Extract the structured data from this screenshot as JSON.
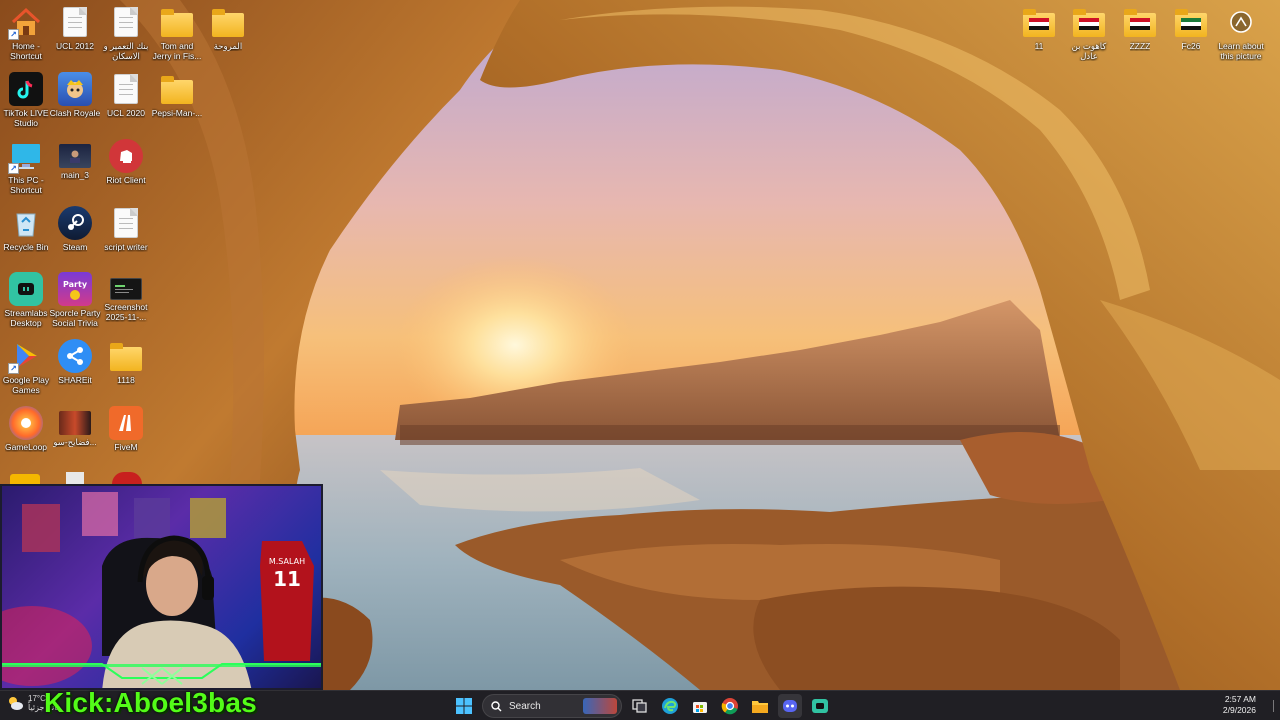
{
  "desktop": {
    "icons": [
      {
        "id": "home",
        "label": "Home - Shortcut",
        "icon": "home-icon"
      },
      {
        "id": "ucl2012",
        "label": "UCL 2012",
        "icon": "document-icon"
      },
      {
        "id": "bank",
        "label": "بنك التعمير و الاسكان",
        "icon": "document-icon"
      },
      {
        "id": "tomjerry",
        "label": "Tom and Jerry in Fis...",
        "icon": "folder-icon"
      },
      {
        "id": "fan",
        "label": "المروحة",
        "icon": "folder-icon"
      },
      {
        "id": "tiktok",
        "label": "TikTok LIVE Studio",
        "icon": "tiktok-icon"
      },
      {
        "id": "clash",
        "label": "Clash Royale",
        "icon": "clash-royale-icon"
      },
      {
        "id": "ucl2020",
        "label": "UCL 2020",
        "icon": "document-icon"
      },
      {
        "id": "pepsi",
        "label": "Pepsi-Man-...",
        "icon": "folder-icon"
      },
      {
        "id": "thispc",
        "label": "This PC - Shortcut",
        "icon": "monitor-icon"
      },
      {
        "id": "main3",
        "label": "main_3",
        "icon": "video-thumbnail-icon"
      },
      {
        "id": "riot",
        "label": "Riot Client",
        "icon": "riot-icon"
      },
      {
        "id": "recycle",
        "label": "Recycle Bin",
        "icon": "recycle-bin-icon"
      },
      {
        "id": "steam",
        "label": "Steam",
        "icon": "steam-icon"
      },
      {
        "id": "script",
        "label": "script writer",
        "icon": "document-icon"
      },
      {
        "id": "streamlabs",
        "label": "Streamlabs Desktop",
        "icon": "streamlabs-icon"
      },
      {
        "id": "sporcle",
        "label": "Sporcle Party Social Trivia",
        "icon": "sporcle-icon"
      },
      {
        "id": "screenshot",
        "label": "Screenshot 2025-11-...",
        "icon": "image-thumbnail-icon"
      },
      {
        "id": "gplay",
        "label": "Google Play Games",
        "icon": "google-play-icon"
      },
      {
        "id": "shareit",
        "label": "SHAREit",
        "icon": "shareit-icon"
      },
      {
        "id": "f1118",
        "label": "1118",
        "icon": "folder-icon"
      },
      {
        "id": "gameloop",
        "label": "GameLoop",
        "icon": "gameloop-icon"
      },
      {
        "id": "scandals",
        "label": "فضايح-سو...",
        "icon": "video-thumbnail-icon"
      },
      {
        "id": "fivem",
        "label": "FiveM",
        "icon": "fivem-icon"
      }
    ],
    "right_icons": [
      {
        "id": "r11",
        "label": "11",
        "icon": "folder-flag-icon"
      },
      {
        "id": "kahoot",
        "label": "كاهوت بن عادل",
        "icon": "folder-flag-icon"
      },
      {
        "id": "zzzz",
        "label": "ZZZZ",
        "icon": "folder-flag-icon"
      },
      {
        "id": "fc26",
        "label": "Fc26",
        "icon": "folder-flag-icon"
      },
      {
        "id": "learn",
        "label": "Learn about this picture",
        "icon": "camera-info-icon"
      }
    ]
  },
  "overlay": {
    "kick_text": "Kick:Aboel3bas",
    "jersey_name": "M.SALAH",
    "jersey_number": "11"
  },
  "taskbar": {
    "weather_temp": "17°C",
    "weather_cond": "غائم جزئياً",
    "search_placeholder": "Search",
    "time": "2:57 AM",
    "date": "2/9/2026"
  },
  "colors": {
    "kick_green": "#53fc18",
    "taskbar_bg": "#202026",
    "folder_yellow": "#f2b41f"
  }
}
